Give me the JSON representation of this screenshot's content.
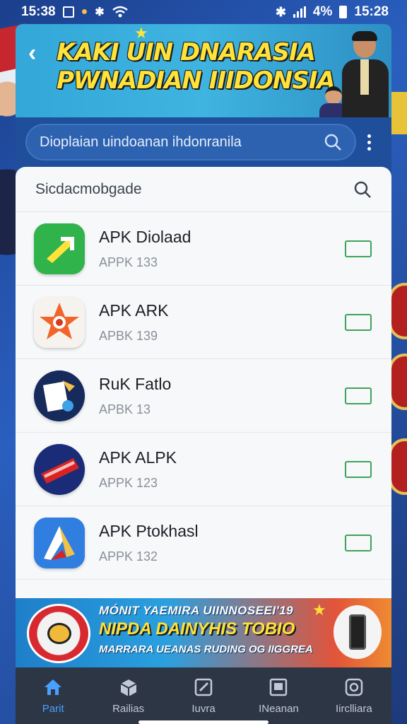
{
  "status_bar": {
    "time_left": "15:38",
    "battery": "4%",
    "time_right": "15:28"
  },
  "header": {
    "banner_title": "KAKI UIN DNARASIA PWNADIAN IIIDONSIA"
  },
  "search": {
    "placeholder": "Dioplaian uindoanan ihdonranila"
  },
  "card": {
    "title": "Sicdacmobgade",
    "items": [
      {
        "name": "APK Diolaad",
        "sub": "APPK 133",
        "icon": "green-download-icon"
      },
      {
        "name": "APK ARK",
        "sub": "APBK 139",
        "icon": "orange-star-icon"
      },
      {
        "name": "RuK Fatlo",
        "sub": "APBK 13",
        "icon": "document-brush-icon"
      },
      {
        "name": "APK ALPK",
        "sub": "APPK 123",
        "icon": "red-ticket-icon"
      },
      {
        "name": "APK Ptokhasl",
        "sub": "APPK 132",
        "icon": "blue-arrow-icon"
      }
    ]
  },
  "promo": {
    "line1": "MÓNIT YAEMIRA UIINNOSEEI'19",
    "line2": "NIPDA DAINYHIS TOBIO",
    "line3": "MARRARA UEANAS RUDING OG IIGGREA"
  },
  "bottom_nav": [
    {
      "label": "Parit",
      "icon": "home-icon",
      "active": true
    },
    {
      "label": "Railias",
      "icon": "box-icon",
      "active": false
    },
    {
      "label": "Iuvra",
      "icon": "edit-icon",
      "active": false
    },
    {
      "label": "INeanan",
      "icon": "screen-icon",
      "active": false
    },
    {
      "label": "Iirclliara",
      "icon": "settings-icon",
      "active": false
    }
  ],
  "colors": {
    "accent": "#4aa0ff",
    "download_box": "#3ea35a",
    "banner_text": "#ffe23a"
  }
}
